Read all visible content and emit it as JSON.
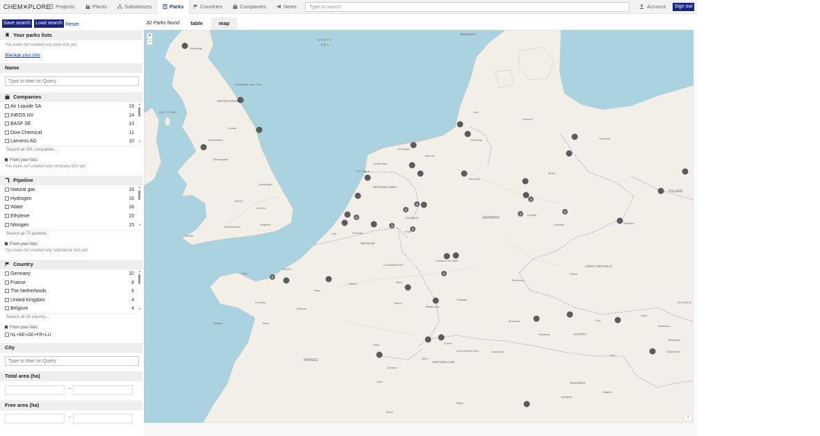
{
  "app": {
    "logo": "CHEM✕PLORE"
  },
  "nav": {
    "items": [
      {
        "label": "Projects",
        "icon": "document-icon"
      },
      {
        "label": "Plants",
        "icon": "plant-icon"
      },
      {
        "label": "Substances",
        "icon": "molecule-icon"
      },
      {
        "label": "Parks",
        "icon": "building-icon",
        "active": true
      },
      {
        "label": "Countries",
        "icon": "flag-icon"
      },
      {
        "label": "Companies",
        "icon": "company-icon"
      },
      {
        "label": "News",
        "icon": "megaphone-icon"
      }
    ],
    "search_placeholder": "Type to search",
    "account": "Account",
    "signout": "Sign out"
  },
  "sidebar": {
    "save_search": "Save search",
    "load_search": "Load search",
    "reset": "Reset",
    "park_lists": {
      "title": "Your parks lists",
      "empty": "You have not created any park lists yet.",
      "manage": "Manage your lists"
    },
    "name": {
      "title": "Name",
      "placeholder": "Type to filter on Query"
    },
    "companies": {
      "title": "Companies",
      "items": [
        {
          "label": "Air Liquide SA",
          "count": "19"
        },
        {
          "label": "INEOS NV",
          "count": "14"
        },
        {
          "label": "BASF SE",
          "count": "13"
        },
        {
          "label": "Dow Chemical",
          "count": "11"
        },
        {
          "label": "Lanxess AG",
          "count": "10"
        }
      ],
      "search_all": "Search all 391 companies...",
      "from_lists": "From your lists:",
      "from_lists_empty": "You have not created any company lists yet."
    },
    "pipeline": {
      "title": "Pipeline",
      "items": [
        {
          "label": "Natural gas",
          "count": "18"
        },
        {
          "label": "Hydrogen",
          "count": "16"
        },
        {
          "label": "Water",
          "count": "16"
        },
        {
          "label": "Ethylene",
          "count": "15"
        },
        {
          "label": "Nitrogen",
          "count": "15"
        }
      ],
      "search_all": "Search all 70 pipeline...",
      "from_lists": "From your lists:",
      "from_lists_empty": "You have not created any substance lists yet."
    },
    "country": {
      "title": "Country",
      "items": [
        {
          "label": "Germany",
          "count": "32"
        },
        {
          "label": "France",
          "count": "8"
        },
        {
          "label": "The Netherlands",
          "count": "6"
        },
        {
          "label": "United Kingdom",
          "count": "4"
        },
        {
          "label": "Belgium",
          "count": "4"
        }
      ],
      "search_all": "Search all 24 country...",
      "from_lists": "From your lists:",
      "list_item": "NL+BE+DE+FR+LU"
    },
    "city": {
      "title": "City",
      "placeholder": "Type to filter on Query"
    },
    "total_area": {
      "title": "Total area (ha)",
      "arrow": "→"
    },
    "free_area": {
      "title": "Free area (ha)",
      "arrow": "→"
    }
  },
  "results": {
    "found": "82 Parks found",
    "tabs": [
      {
        "label": "table"
      },
      {
        "label": "map",
        "active": true
      }
    ]
  },
  "map": {
    "zoom_in": "+",
    "zoom_out": "−",
    "attribution": "i",
    "labels": [
      {
        "text": "NORTH",
        "kind": "sea"
      },
      {
        "text": "SEA",
        "kind": "sea"
      },
      {
        "text": "UNITED KINGDOM",
        "kind": "country"
      },
      {
        "text": "DENMARK",
        "kind": "country"
      },
      {
        "text": "ISLE OF MAN",
        "kind": "region"
      },
      {
        "text": "NETHERLANDS",
        "kind": "country"
      },
      {
        "text": "BELGIUM",
        "kind": "country"
      },
      {
        "text": "LUXEMBOURG",
        "kind": "country"
      },
      {
        "text": "GERMANY",
        "kind": "country"
      },
      {
        "text": "POLAND",
        "kind": "country"
      },
      {
        "text": "CZECH REPUBLIC",
        "kind": "country"
      },
      {
        "text": "AUSTRIA",
        "kind": "country"
      },
      {
        "text": "SWITZERLAND",
        "kind": "country"
      },
      {
        "text": "LIECHTENSTEIN",
        "kind": "country"
      },
      {
        "text": "FRANCE",
        "kind": "country"
      },
      {
        "text": "SLOVENIA",
        "kind": "country"
      },
      {
        "text": "SLOVAKIA",
        "kind": "country"
      },
      {
        "text": "HUNGARY",
        "kind": "country"
      },
      {
        "text": "Edinburgh",
        "kind": "city"
      },
      {
        "text": "Newcastle upon Tyne",
        "kind": "city"
      },
      {
        "text": "Leeds",
        "kind": "city"
      },
      {
        "text": "Manchester",
        "kind": "city"
      },
      {
        "text": "Birmingham",
        "kind": "city"
      },
      {
        "text": "Cambridge",
        "kind": "city"
      },
      {
        "text": "London",
        "kind": "city"
      },
      {
        "text": "Oxford",
        "kind": "city"
      },
      {
        "text": "Southampton",
        "kind": "city"
      },
      {
        "text": "Exeter",
        "kind": "city"
      },
      {
        "text": "Brighton",
        "kind": "city"
      },
      {
        "text": "Amsterdam",
        "kind": "city"
      },
      {
        "text": "The Hague",
        "kind": "city"
      },
      {
        "text": "Groningen",
        "kind": "city"
      },
      {
        "text": "Brussels",
        "kind": "city"
      },
      {
        "text": "Lille",
        "kind": "city"
      },
      {
        "text": "Paris",
        "kind": "city"
      },
      {
        "text": "Rouen",
        "kind": "city"
      },
      {
        "text": "Caen",
        "kind": "city"
      },
      {
        "text": "Le Mans",
        "kind": "city"
      },
      {
        "text": "Nantes",
        "kind": "city"
      },
      {
        "text": "Tours",
        "kind": "city"
      },
      {
        "text": "Orléans",
        "kind": "city"
      },
      {
        "text": "Reims",
        "kind": "city"
      },
      {
        "text": "Metz",
        "kind": "city"
      },
      {
        "text": "Nancy",
        "kind": "city"
      },
      {
        "text": "Strasbourg",
        "kind": "city"
      },
      {
        "text": "Dijon",
        "kind": "city"
      },
      {
        "text": "Lyon",
        "kind": "city"
      },
      {
        "text": "Geneva",
        "kind": "city"
      },
      {
        "text": "Bern",
        "kind": "city"
      },
      {
        "text": "Zürich",
        "kind": "city"
      },
      {
        "text": "Hamburg",
        "kind": "city"
      },
      {
        "text": "Bremen",
        "kind": "city"
      },
      {
        "text": "Hannover",
        "kind": "city"
      },
      {
        "text": "Berlin",
        "kind": "city"
      },
      {
        "text": "Leipzig",
        "kind": "city"
      },
      {
        "text": "Dresden",
        "kind": "city"
      },
      {
        "text": "Köln",
        "kind": "city"
      },
      {
        "text": "Düsseldorf",
        "kind": "city"
      },
      {
        "text": "Frankfurt am Main",
        "kind": "city"
      },
      {
        "text": "Stuttgart",
        "kind": "city"
      },
      {
        "text": "München",
        "kind": "city"
      },
      {
        "text": "Nürnberg",
        "kind": "city"
      },
      {
        "text": "Praha",
        "kind": "city"
      },
      {
        "text": "Wien",
        "kind": "city"
      },
      {
        "text": "Bratislava",
        "kind": "city"
      },
      {
        "text": "Budapest",
        "kind": "city"
      },
      {
        "text": "Wrocław",
        "kind": "city"
      },
      {
        "text": "Szczecin",
        "kind": "city"
      },
      {
        "text": "Kiel",
        "kind": "city"
      },
      {
        "text": "Rostock",
        "kind": "city"
      },
      {
        "text": "Milan",
        "kind": "city"
      },
      {
        "text": "Torino",
        "kind": "city"
      },
      {
        "text": "Ljubljana",
        "kind": "city"
      },
      {
        "text": "Zagreb",
        "kind": "city"
      },
      {
        "text": "Graz",
        "kind": "city"
      },
      {
        "text": "Linz",
        "kind": "city"
      },
      {
        "text": "Salzburg",
        "kind": "city"
      },
      {
        "text": "Innsbruck",
        "kind": "city"
      }
    ],
    "clusters": [
      {
        "count": "3"
      },
      {
        "count": "2"
      },
      {
        "count": "4"
      },
      {
        "count": "3"
      },
      {
        "count": "3"
      },
      {
        "count": "5"
      },
      {
        "count": "2"
      },
      {
        "count": "2"
      },
      {
        "count": "2"
      },
      {
        "count": "4"
      },
      {
        "count": "2"
      }
    ]
  }
}
